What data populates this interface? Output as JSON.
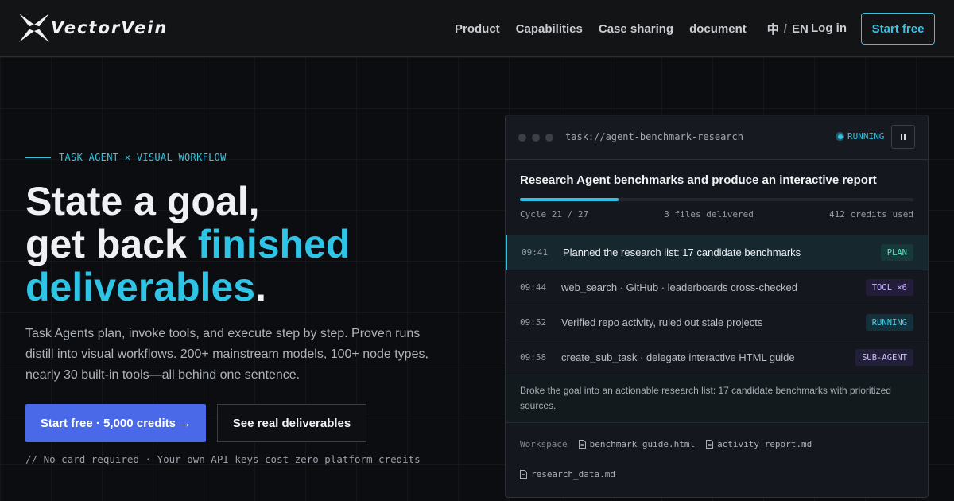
{
  "brand": {
    "name": "VectorVein"
  },
  "nav": {
    "links": [
      "Product",
      "Capabilities",
      "Case sharing",
      "document"
    ],
    "lang_zh": "中",
    "lang_sep": "/",
    "lang_en": "EN",
    "login": "Log in",
    "start_free": "Start free"
  },
  "hero": {
    "eyebrow": "TASK AGENT × VISUAL WORKFLOW",
    "headline_1": "State a goal,",
    "headline_2a": "get back ",
    "headline_2b": "finished",
    "headline_3a": "deliverables",
    "headline_3b": ".",
    "subtext": "Task Agents plan, invoke tools, and execute step by step. Proven runs distill into visual workflows. 200+ mainstream models, 100+ node types, nearly 30 built-in tools—all behind one sentence.",
    "primary_cta": "Start free · 5,000 credits →",
    "secondary_cta": "See real deliverables",
    "footnote": "// No card required · Your own API keys cost zero platform credits"
  },
  "card": {
    "task_url": "task://agent-benchmark-research",
    "status": "RUNNING",
    "title": "Research Agent benchmarks and produce an interactive report",
    "progress": 0.25,
    "cycle": "Cycle 21 / 27",
    "files_delivered": "3 files delivered",
    "credits_used": "412 credits used",
    "rows": [
      {
        "time": "09:41",
        "desc": "Planned the research list: 17 candidate benchmarks",
        "tag": "PLAN"
      },
      {
        "time": "09:44",
        "desc": "web_search · GitHub · leaderboards cross-checked",
        "tag": "TOOL ×6"
      },
      {
        "time": "09:52",
        "desc": "Verified repo activity, ruled out stale projects",
        "tag": "RUNNING"
      },
      {
        "time": "09:58",
        "desc": "create_sub_task · delegate interactive HTML guide",
        "tag": "SUB-AGENT"
      }
    ],
    "summary": "Broke the goal into an actionable research list: 17 candidate benchmarks with prioritized sources.",
    "workspace_label": "Workspace",
    "files": [
      "benchmark_guide.html",
      "activity_report.md",
      "research_data.md"
    ]
  },
  "colors": {
    "accent": "#2ec4e6",
    "primary_button": "#4a69e8",
    "background": "#0b0d10"
  }
}
